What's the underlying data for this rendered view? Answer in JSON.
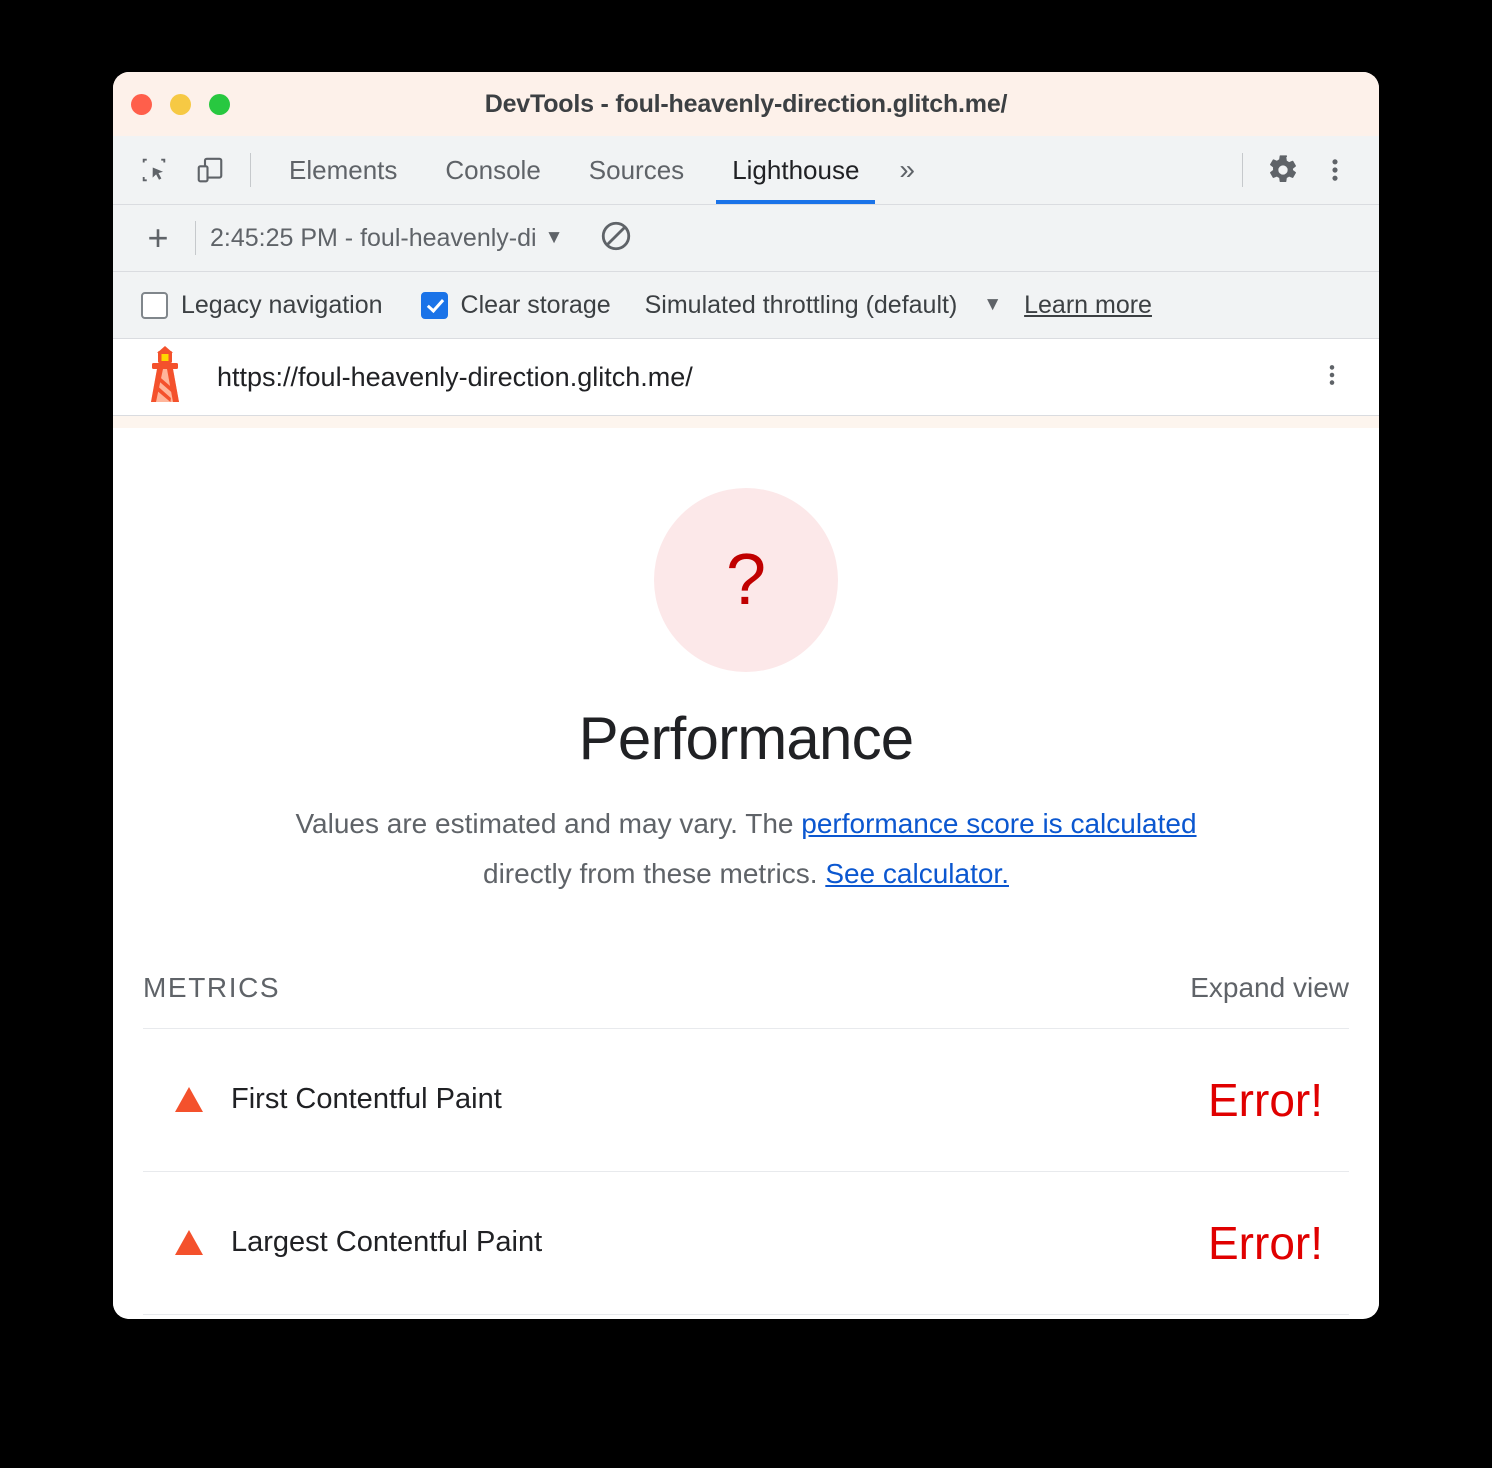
{
  "window": {
    "title": "DevTools - foul-heavenly-direction.glitch.me/"
  },
  "toolbar": {
    "inspect_icon": "inspect-element-icon",
    "device_icon": "device-toolbar-icon",
    "settings_icon": "gear-icon",
    "more_icon": "kebab-menu-icon",
    "tabs": [
      {
        "label": "Elements",
        "active": false
      },
      {
        "label": "Console",
        "active": false
      },
      {
        "label": "Sources",
        "active": false
      },
      {
        "label": "Lighthouse",
        "active": true
      }
    ],
    "overflow_label": "»",
    "active_tab_underline_color": "#1a73e8"
  },
  "runbar": {
    "add_label": "+",
    "selected_run": "2:45:25 PM - foul-heavenly-di",
    "dropdown_caret": "▼",
    "clear_icon": "ban-clear-icon"
  },
  "options": {
    "legacy_navigation": {
      "label": "Legacy navigation",
      "checked": false
    },
    "clear_storage": {
      "label": "Clear storage",
      "checked": true
    },
    "throttling": {
      "label": "Simulated throttling (default)",
      "caret": "▼"
    },
    "learn_more": "Learn more",
    "checkbox_accent": "#1a73e8"
  },
  "urlbar": {
    "icon": "lighthouse-icon",
    "url": "https://foul-heavenly-direction.glitch.me/",
    "more_icon": "kebab-menu-icon"
  },
  "report": {
    "gauge": {
      "symbol": "?",
      "fill_color": "#fce8e9",
      "text_color": "#c00000"
    },
    "category_title": "Performance",
    "description": {
      "part1": "Values are estimated and may vary. The ",
      "link1": "performance score is calculated",
      "part2": " directly from these metrics. ",
      "link2": "See calculator.",
      "link_color": "#0b57d0"
    },
    "metrics_section": {
      "heading": "METRICS",
      "expand_label": "Expand view",
      "error_color": "#e00000",
      "rows": [
        {
          "icon": "warning-triangle-icon",
          "name": "First Contentful Paint",
          "value": "Error!"
        },
        {
          "icon": "warning-triangle-icon",
          "name": "Largest Contentful Paint",
          "value": "Error!"
        }
      ]
    }
  }
}
